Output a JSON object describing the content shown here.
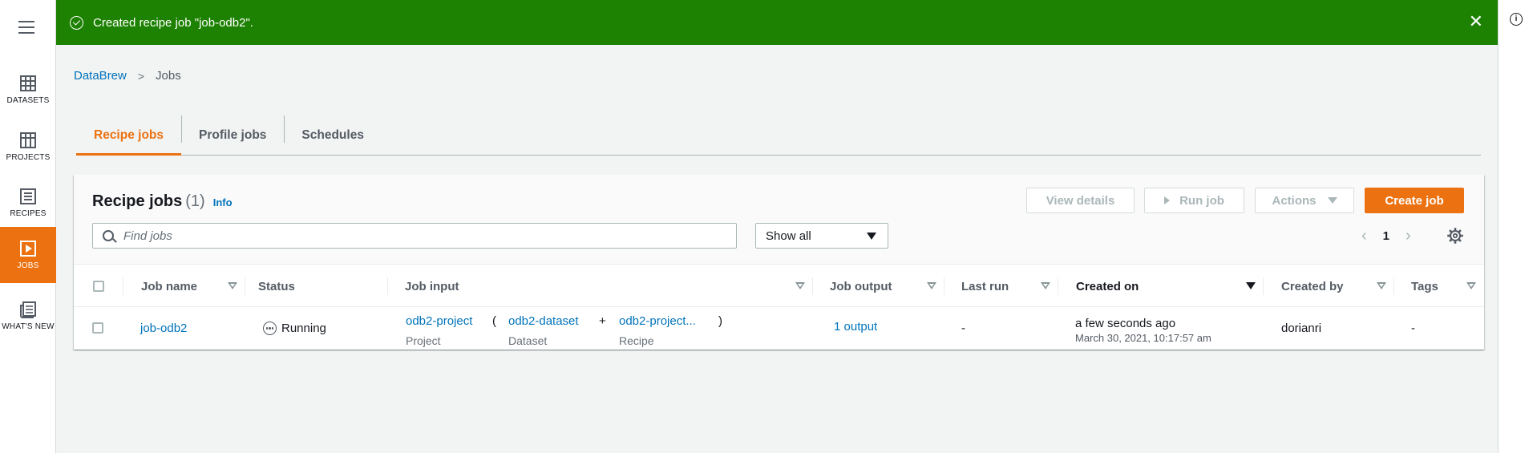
{
  "flash": {
    "message": "Created recipe job \"job-odb2\".",
    "close": "✕",
    "color": "#1d8102"
  },
  "nav": {
    "items": [
      {
        "label": "DATASETS",
        "icon": "table-icon"
      },
      {
        "label": "PROJECTS",
        "icon": "grid-icon"
      },
      {
        "label": "RECIPES",
        "icon": "list-icon"
      },
      {
        "label": "JOBS",
        "icon": "play-icon",
        "active": true
      },
      {
        "label": "WHAT'S NEW",
        "icon": "news-icon"
      }
    ]
  },
  "breadcrumb": {
    "root": "DataBrew",
    "current": "Jobs"
  },
  "tabs": [
    {
      "label": "Recipe jobs",
      "active": true
    },
    {
      "label": "Profile jobs"
    },
    {
      "label": "Schedules"
    }
  ],
  "panel": {
    "title": "Recipe jobs",
    "count": "(1)",
    "info": "Info",
    "buttons": {
      "view_details": "View details",
      "run_job": "Run job",
      "actions": "Actions",
      "create_job": "Create job"
    },
    "search_placeholder": "Find jobs",
    "filter_value": "Show all",
    "page": "1"
  },
  "table": {
    "columns": [
      "Job name",
      "Status",
      "Job input",
      "Job output",
      "Last run",
      "Created on",
      "Created by",
      "Tags"
    ],
    "rows": [
      {
        "job_name": "job-odb2",
        "status": "Running",
        "input_project": "odb2-project",
        "input_project_type": "Project",
        "paren_open": "(",
        "input_dataset": "odb2-dataset",
        "input_dataset_type": "Dataset",
        "plus": "+",
        "input_recipe": "odb2-project...",
        "input_recipe_type": "Recipe",
        "paren_close": ")",
        "job_output": "1 output",
        "last_run": "-",
        "created_on": "a few seconds ago",
        "created_on_full": "March 30, 2021, 10:17:57 am",
        "created_by": "dorianri",
        "tags": "-"
      }
    ]
  },
  "colors": {
    "accent": "#ec7211",
    "link": "#0073bb"
  }
}
